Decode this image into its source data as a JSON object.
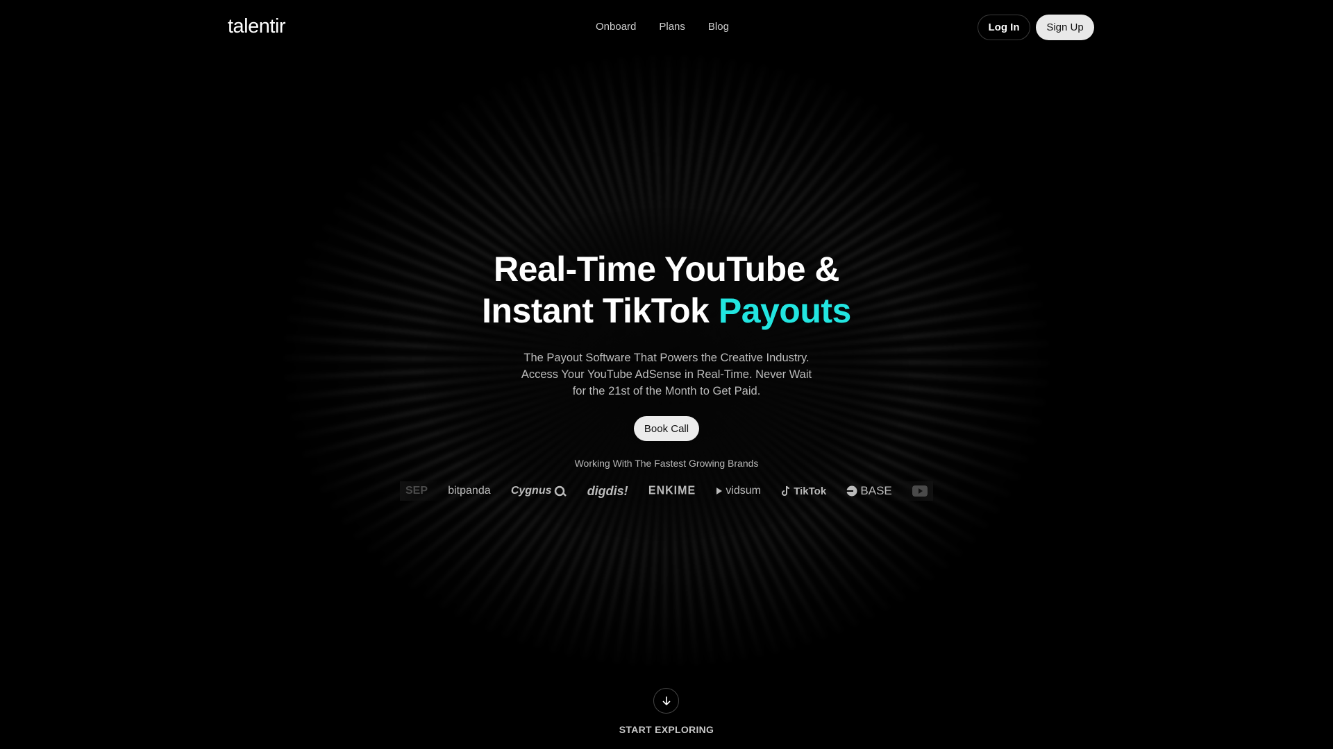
{
  "header": {
    "logo": "talentir",
    "nav": [
      {
        "label": "Onboard"
      },
      {
        "label": "Plans"
      },
      {
        "label": "Blog"
      }
    ],
    "login_label": "Log In",
    "signup_label": "Sign Up"
  },
  "hero": {
    "title_line1": "Real-Time YouTube &",
    "title_line2_prefix": "Instant TikTok",
    "title_line2_accent": "Payouts",
    "subtitle": "The Payout Software That Powers the Creative Industry. Access Your YouTube AdSense in Real-Time. Never Wait for the 21st of the Month to Get Paid.",
    "cta_label": "Book Call",
    "accent_color": "#22e5e0"
  },
  "brands": {
    "label": "Working With The Fastest Growing Brands",
    "items": [
      "SEP",
      "bitpanda",
      "Cygnus",
      "digdis!",
      "ENKIME",
      "vidsum",
      "TikTok",
      "BASE"
    ]
  },
  "footer": {
    "explore_label": "START EXPLORING"
  }
}
